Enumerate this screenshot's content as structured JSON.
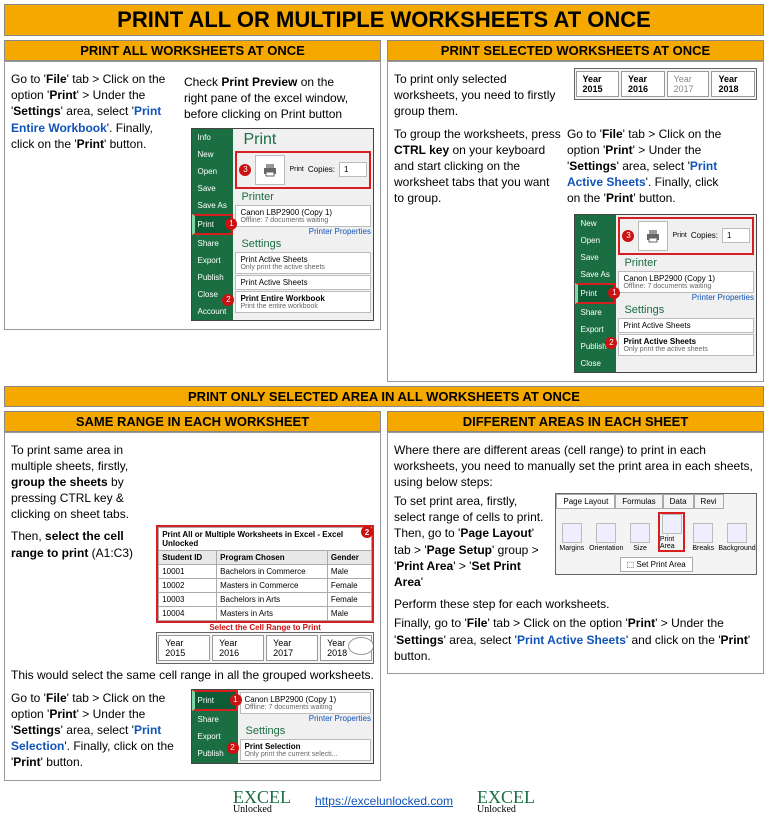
{
  "title": "PRINT ALL OR MULTIPLE WORKSHEETS AT ONCE",
  "sectionA": {
    "heading": "PRINT ALL WORKSHEETS AT ONCE",
    "para1_pre": "Go to '",
    "para1_file": "File",
    "para1_mid1": "' tab > Click on the option '",
    "para1_print": "Print",
    "para1_mid2": "' > Under the '",
    "para1_settings": "Settings",
    "para1_mid3": "' area, select '",
    "para1_opt": "Print Entire Workbook",
    "para1_mid4": "'. Finally, click on the '",
    "para1_btn": "Print",
    "para1_end": "' button.",
    "para2_pre": "Check ",
    "para2_b": "Print Preview",
    "para2_end": " on the right pane of the excel window, before clicking on Print button",
    "shot": {
      "title": "Print",
      "nav": [
        "Info",
        "New",
        "Open",
        "Save",
        "Save As",
        "Print",
        "Share",
        "Export",
        "Publish",
        "Close",
        "Account"
      ],
      "copies_label": "Copies:",
      "copies_value": "1",
      "printer_heading": "Printer",
      "printer_name": "Canon LBP2900 (Copy 1)",
      "printer_status": "Offline: 7 documents waiting",
      "printer_link": "Printer Properties",
      "settings_heading": "Settings",
      "row1_title": "Print Active Sheets",
      "row1_sub": "Only print the active sheets",
      "row_pas": "Print Active Sheets",
      "row2_title": "Print Entire Workbook",
      "row2_sub": "Print the entire workbook",
      "print_label": "Print",
      "b1": "1",
      "b2": "2",
      "b3": "3"
    }
  },
  "sectionB": {
    "heading": "PRINT SELECTED WORKSHEETS AT ONCE",
    "p1": "To print only selected worksheets, you need to firstly group them.",
    "p2_a": "To group the worksheets, press ",
    "p2_b": "CTRL key",
    "p2_c": " on your keyboard and start clicking on the worksheet tabs that you want to group.",
    "p3_pre": "Go to '",
    "p3_file": "File",
    "p3_mid1": "' tab > Click on the option '",
    "p3_print": "Print",
    "p3_mid2": "' > Under the '",
    "p3_settings": "Settings",
    "p3_mid3": "' area, select '",
    "p3_opt": "Print Active Sheets",
    "p3_mid4": "'. Finally, click on the '",
    "p3_btn": "Print",
    "p3_end": "' button.",
    "tabs": [
      "Year 2015",
      "Year 2016",
      "Year 2017",
      "Year 2018"
    ],
    "shot": {
      "nav": [
        "New",
        "Open",
        "Save",
        "Save As",
        "Print",
        "Share",
        "Export",
        "Publish",
        "Close"
      ],
      "copies_label": "Copies:",
      "copies_value": "1",
      "printer_heading": "Printer",
      "printer_name": "Canon LBP2900 (Copy 1)",
      "printer_status": "Offline: 7 documents waiting",
      "printer_link": "Printer Properties",
      "settings_heading": "Settings",
      "row1_title": "Print Active Sheets",
      "row2_title": "Print Active Sheets",
      "row2_sub": "Only print the active sheets",
      "print_label": "Print",
      "b1": "1",
      "b2": "2",
      "b3": "3"
    }
  },
  "sectionMiddle": {
    "heading": "PRINT ONLY SELECTED AREA IN ALL WORKSHEETS AT ONCE"
  },
  "sectionC": {
    "heading": "SAME RANGE IN EACH WORKSHEET",
    "p1_a": "To print same area in multiple sheets, firstly, ",
    "p1_b": "group the sheets",
    "p1_c": " by pressing CTRL key & clicking on sheet tabs.",
    "p2_a": "Then, ",
    "p2_b": "select the cell range to print",
    "p2_c": " (A1:C3)",
    "p3": "This would select the same cell range in all the grouped worksheets.",
    "p4_pre": "Go to '",
    "p4_file": "File",
    "p4_mid1": "' tab > Click on the option '",
    "p4_print": "Print",
    "p4_mid2": "' > Under the '",
    "p4_settings": "Settings",
    "p4_mid3": "' area, select '",
    "p4_opt": "Print Selection",
    "p4_mid4": "'. Finally, click on the '",
    "p4_btn": "Print",
    "p4_end": "' button.",
    "bubble": "Select the Cell Range to Print",
    "sheet": {
      "title": "Print All or Multiple Worksheets in Excel - Excel Unlocked",
      "headers": [
        "Student ID",
        "Program Chosen",
        "Gender"
      ],
      "rows": [
        [
          "10001",
          "Bachelors in Commerce",
          "Male"
        ],
        [
          "10002",
          "Masters in Commerce",
          "Female"
        ],
        [
          "10003",
          "Bachelors in Arts",
          "Female"
        ],
        [
          "10004",
          "Masters in Arts",
          "Male"
        ]
      ],
      "tabs": [
        "Year 2015",
        "Year 2016",
        "Year 2017",
        "Year 2018"
      ],
      "b1": "1",
      "b2": "2"
    },
    "shot": {
      "nav": [
        "Print",
        "Share",
        "Export",
        "Publish"
      ],
      "printer_name": "Canon LBP2900 (Copy 1)",
      "printer_status": "Offline: 7 documents waiting",
      "printer_link": "Printer Properties",
      "settings_heading": "Settings",
      "row1_title": "Print Selection",
      "row1_sub": "Only print the current selecti...",
      "b1": "1",
      "b2": "2"
    }
  },
  "sectionD": {
    "heading": "DIFFERENT AREAS IN EACH SHEET",
    "p1": "Where there are different areas (cell range) to print in each worksheets, you need to manually set the print area in each sheets, using below steps:",
    "p2_a": "To set print area, firstly, select range of cells to print. Then, go to '",
    "p2_b": "Page Layout",
    "p2_c": "' tab > '",
    "p2_d": "Page Setup",
    "p2_e": "' group > '",
    "p2_f": "Print Area",
    "p2_g": "' > '",
    "p2_h": "Set Print Area",
    "p2_i": "'",
    "p3": "Perform these step for each worksheets.",
    "p4_pre": "Finally, go to '",
    "p4_file": "File",
    "p4_mid1": "' tab > Click on the option '",
    "p4_print": "Print",
    "p4_mid2": "' > Under the '",
    "p4_settings": "Settings",
    "p4_mid3": "' area, select '",
    "p4_opt": "Print Active Sheets",
    "p4_mid4": "' and click on the '",
    "p4_btn": "Print",
    "p4_end": "' button.",
    "ribbon": {
      "tabs": [
        "Page Layout",
        "Formulas",
        "Data",
        "Revi"
      ],
      "buttons": [
        "Margins",
        "Orientation",
        "Size",
        "Print Area",
        "Breaks",
        "Background"
      ],
      "menu": "Set Print Area"
    }
  },
  "footer": {
    "brand_top": "EXCEL",
    "brand_bot": "Unlocked",
    "url_text": "https://excelunlocked.com",
    "url_href": "https://excelunlocked.com"
  }
}
